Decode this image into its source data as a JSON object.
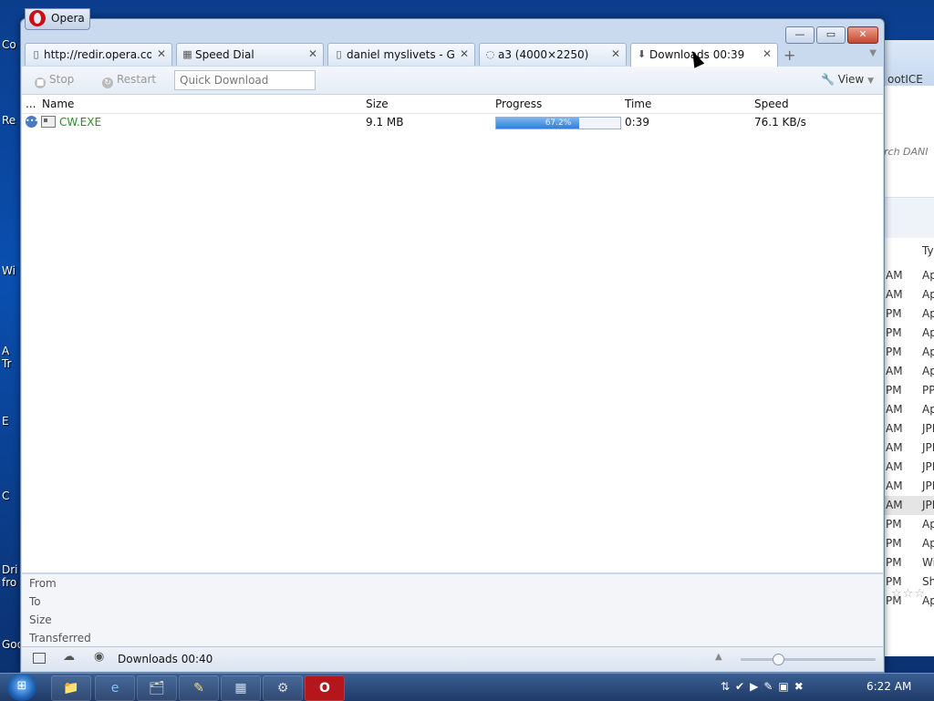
{
  "desktop": {
    "labels": [
      "Co",
      "Re",
      "Wi",
      "A\nTr",
      "E",
      "C",
      "Dri\nfro",
      "Goo"
    ]
  },
  "background_window": {
    "address_text": "ootICE",
    "search_placeholder": "rch DANI",
    "column_header": "Ty",
    "rows": [
      {
        "time": "AM",
        "kind": "Ap"
      },
      {
        "time": "AM",
        "kind": "Ap"
      },
      {
        "time": "PM",
        "kind": "Ap"
      },
      {
        "time": "PM",
        "kind": "Ap"
      },
      {
        "time": "PM",
        "kind": "Ap"
      },
      {
        "time": "AM",
        "kind": "Ap"
      },
      {
        "time": "PM",
        "kind": "PP"
      },
      {
        "time": "AM",
        "kind": "Ap"
      },
      {
        "time": "AM",
        "kind": "JPE"
      },
      {
        "time": "AM",
        "kind": "JPE"
      },
      {
        "time": "AM",
        "kind": "JPE"
      },
      {
        "time": "AM",
        "kind": "JPE"
      },
      {
        "time": "AM",
        "kind": "JPE"
      },
      {
        "time": "PM",
        "kind": "Ap"
      },
      {
        "time": "PM",
        "kind": "Ap"
      },
      {
        "time": "PM",
        "kind": "Wi"
      },
      {
        "time": "PM",
        "kind": "Sh"
      },
      {
        "time": "PM",
        "kind": "Ap"
      }
    ],
    "selected_row_index": 12,
    "stars": "☆☆☆"
  },
  "opera": {
    "menu_label": "Opera",
    "window_buttons": {
      "minimize": "—",
      "maximize": "▭",
      "close": "✕"
    },
    "tabs": [
      {
        "label": "http://redir.opera.co...",
        "icon": "page-icon",
        "close": "✕"
      },
      {
        "label": "Speed Dial",
        "icon": "speed-dial-icon",
        "close": "✕"
      },
      {
        "label": "daniel myslivets - Go...",
        "icon": "page-icon",
        "close": "✕"
      },
      {
        "label": "a3 (4000×2250)",
        "icon": "loading-icon",
        "close": "✕"
      },
      {
        "label": "Downloads 00:39",
        "icon": "downloads-icon",
        "close": "✕"
      }
    ],
    "active_tab_index": 4,
    "new_tab": "+",
    "toolbar": {
      "stop_label": "Stop",
      "restart_label": "Restart",
      "quick_download_placeholder": "Quick Download",
      "view_label": "View"
    },
    "columns": {
      "more": "...",
      "name": "Name",
      "size": "Size",
      "progress": "Progress",
      "time": "Time",
      "speed": "Speed"
    },
    "downloads": [
      {
        "name": "CW.EXE",
        "size": "9.1 MB",
        "progress_text": "67.2%",
        "progress": 0.672,
        "time": "0:39",
        "speed": "76.1 KB/s"
      }
    ],
    "details": {
      "from_label": "From",
      "to_label": "To",
      "size_label": "Size",
      "transferred_label": "Transferred"
    },
    "statusbar": {
      "text": "Downloads 00:40",
      "zoom_level": 0.28
    }
  },
  "taskbar": {
    "start_label": "⊞",
    "items": [
      "📁",
      "e",
      "🗂",
      "✎",
      "▦",
      "⚙",
      "O"
    ],
    "tray_icons": "⇅✔▶✎▣✖",
    "clock": "6:22 AM"
  },
  "colors": {
    "file_name": "#2f8a2f",
    "progress_fill": "#2f7fd6",
    "window_frame": "#c9d9ee",
    "desktop": "#0a4fb0"
  }
}
